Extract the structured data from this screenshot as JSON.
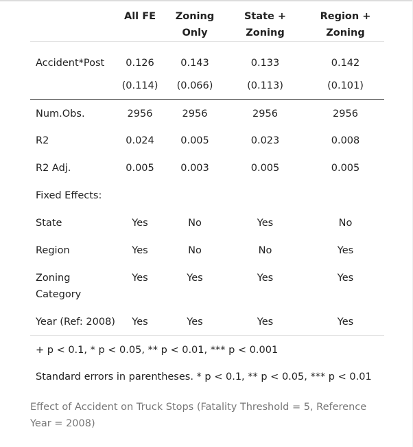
{
  "table": {
    "headers": [
      "",
      "All FE",
      "Zoning\nOnly",
      "State +\nZoning",
      "Region +\nZoning"
    ],
    "header_lines": [
      [],
      [
        "All FE"
      ],
      [
        "Zoning",
        "Only"
      ],
      [
        "State +",
        "Zoning"
      ],
      [
        "Region +",
        "Zoning"
      ]
    ],
    "rows": [
      {
        "label": "Accident*Post",
        "values": [
          "0.126",
          "0.143",
          "0.133",
          "0.142"
        ]
      },
      {
        "label": "",
        "values": [
          "(0.114)",
          "(0.066)",
          "(0.113)",
          "(0.101)"
        ]
      },
      {
        "label": "Num.Obs.",
        "values": [
          "2956",
          "2956",
          "2956",
          "2956"
        ]
      },
      {
        "label": "R2",
        "values": [
          "0.024",
          "0.005",
          "0.023",
          "0.008"
        ]
      },
      {
        "label": "R2 Adj.",
        "values": [
          "0.005",
          "0.003",
          "0.005",
          "0.005"
        ]
      },
      {
        "label": "Fixed Effects:",
        "values": [
          "",
          "",
          "",
          ""
        ]
      },
      {
        "label": "State",
        "values": [
          "Yes",
          "No",
          "Yes",
          "No"
        ]
      },
      {
        "label": "Region",
        "values": [
          "Yes",
          "No",
          "No",
          "Yes"
        ]
      },
      {
        "label": "Zoning Category",
        "values": [
          "Yes",
          "Yes",
          "Yes",
          "Yes"
        ]
      },
      {
        "label": "Year (Ref: 2008)",
        "values": [
          "Yes",
          "Yes",
          "Yes",
          "Yes"
        ]
      }
    ],
    "notes": [
      "+ p < 0.1, * p < 0.05, ** p < 0.01, *** p < 0.001",
      "Standard errors in parentheses. * p < 0.1, ** p < 0.05, *** p < 0.01"
    ]
  },
  "caption": "Effect of Accident on Truck Stops (Fatality Threshold = 5, Reference Year = 2008)"
}
